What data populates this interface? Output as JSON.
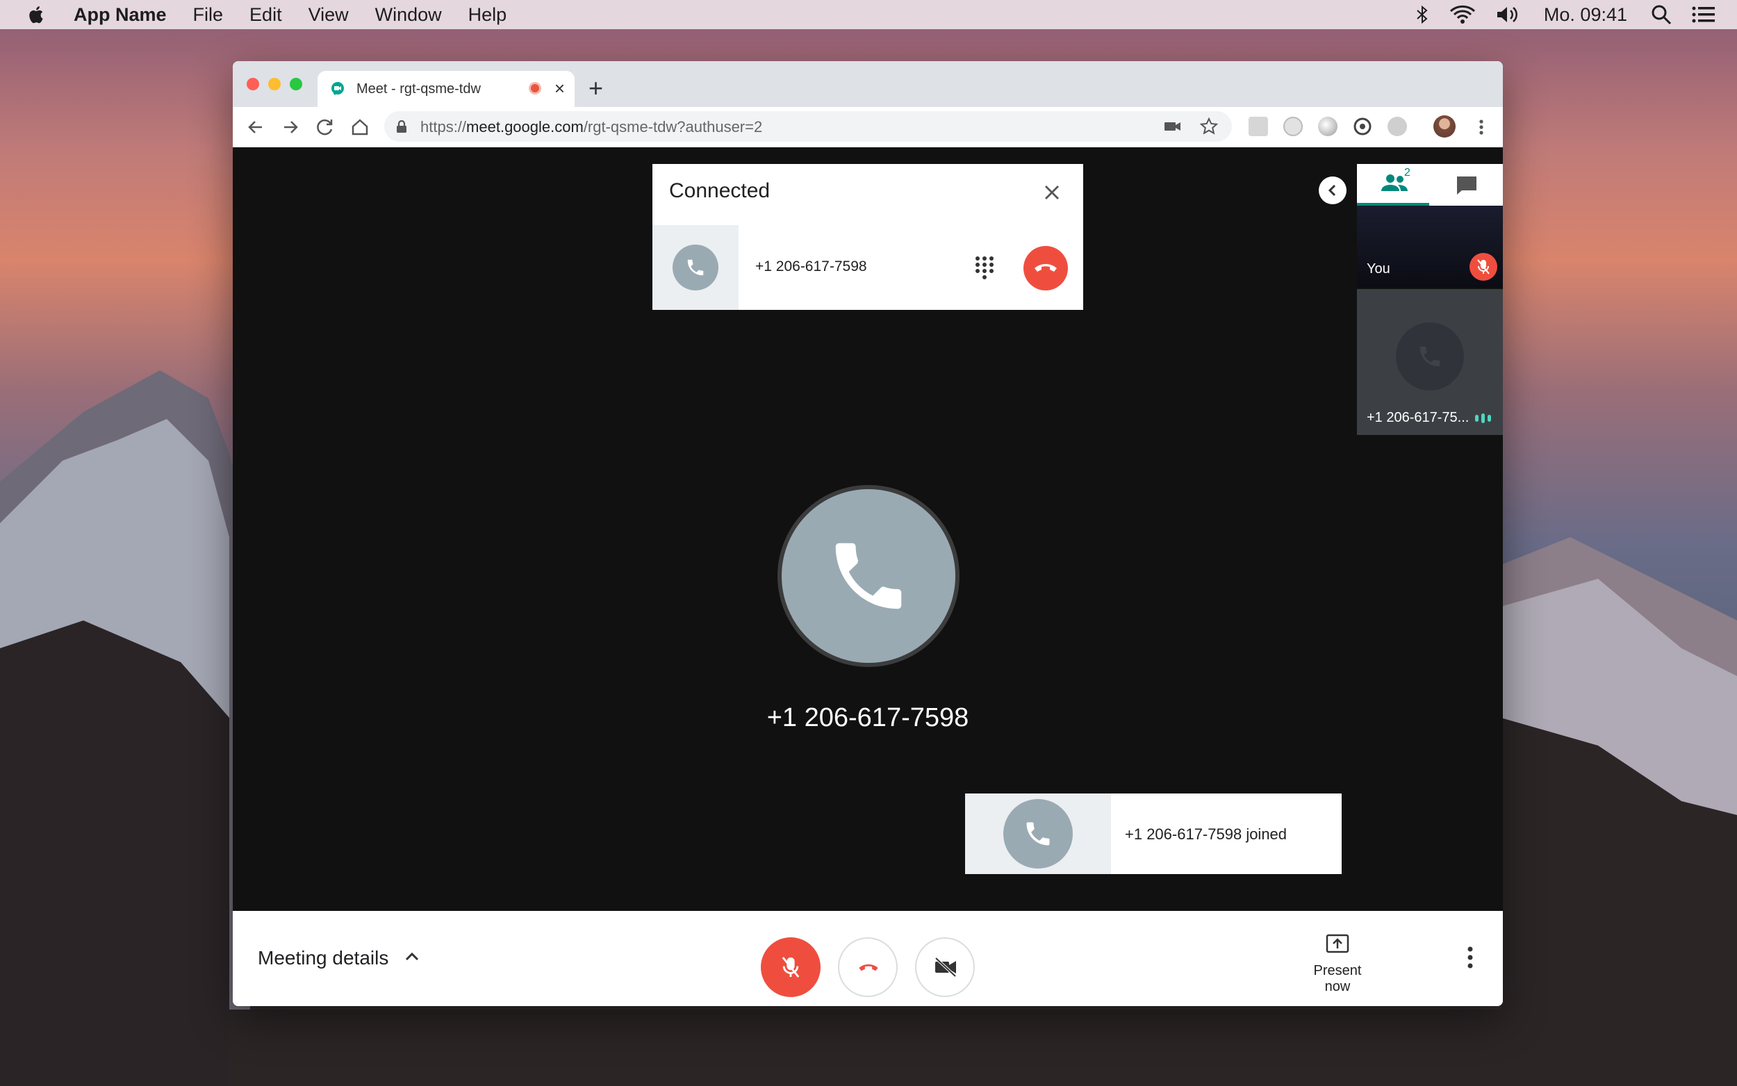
{
  "menubar": {
    "app_name": "App Name",
    "items": [
      "File",
      "Edit",
      "View",
      "Window",
      "Help"
    ],
    "clock": "Mo. 09:41",
    "status_icons": [
      "bluetooth-icon",
      "wifi-icon",
      "volume-icon",
      "search-icon",
      "list-icon"
    ]
  },
  "browser": {
    "tab_title": "Meet - rgt-qsme-tdw",
    "new_tab": "+",
    "url_prefix": "https://",
    "url_host": "meet.google.com",
    "url_path": "/rgt-qsme-tdw?authuser=2"
  },
  "connected_card": {
    "title": "Connected",
    "phone_number": "+1 206-617-7598"
  },
  "main": {
    "caller_number": "+1 206-617-7598"
  },
  "toast": {
    "text": "+1 206-617-7598 joined"
  },
  "sidebar": {
    "participants_count": "2",
    "you_label": "You",
    "phone_participant_label": "+1 206-617-75..."
  },
  "bottom_bar": {
    "meeting_details": "Meeting details",
    "present_now": "Present now"
  },
  "colors": {
    "accent": "#00897b",
    "hangup": "#ef4e3f",
    "avatar": "#9aaab3",
    "stage": "#111111"
  }
}
